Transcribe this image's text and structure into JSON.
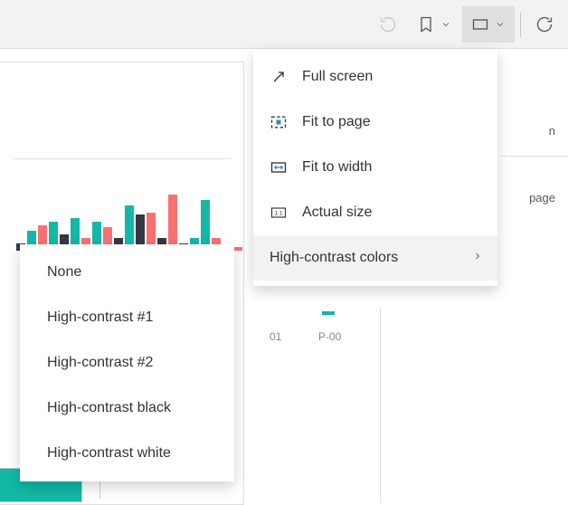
{
  "view_menu": {
    "items": [
      {
        "label": "Full screen"
      },
      {
        "label": "Fit to page"
      },
      {
        "label": "Fit to width"
      },
      {
        "label": "Actual size"
      },
      {
        "label": "High-contrast colors"
      }
    ]
  },
  "contrast_submenu": {
    "items": [
      {
        "label": "None"
      },
      {
        "label": "High-contrast #1"
      },
      {
        "label": "High-contrast #2"
      },
      {
        "label": "High-contrast black"
      },
      {
        "label": "High-contrast white"
      }
    ]
  },
  "sidebar": {
    "label_top_fragment": "n",
    "label_page": "page"
  },
  "axis": {
    "tick_01": "01",
    "tick_p00": "P-00"
  },
  "chart_data": {
    "type": "bar",
    "note": "partial bar chart in background; values are relative pixel heights only (no axis labels visible)",
    "series_colors": [
      "#333842",
      "#13b8a6",
      "#f87171"
    ],
    "bars_heights": [
      8,
      22,
      28,
      32,
      18,
      36,
      14,
      32,
      26,
      14,
      50,
      40,
      42,
      14,
      62,
      8,
      14,
      56,
      14,
      4,
      4
    ],
    "bars_series": [
      0,
      1,
      2,
      1,
      0,
      1,
      2,
      1,
      2,
      0,
      1,
      0,
      2,
      0,
      2,
      0,
      1,
      1,
      2,
      0,
      2
    ]
  }
}
